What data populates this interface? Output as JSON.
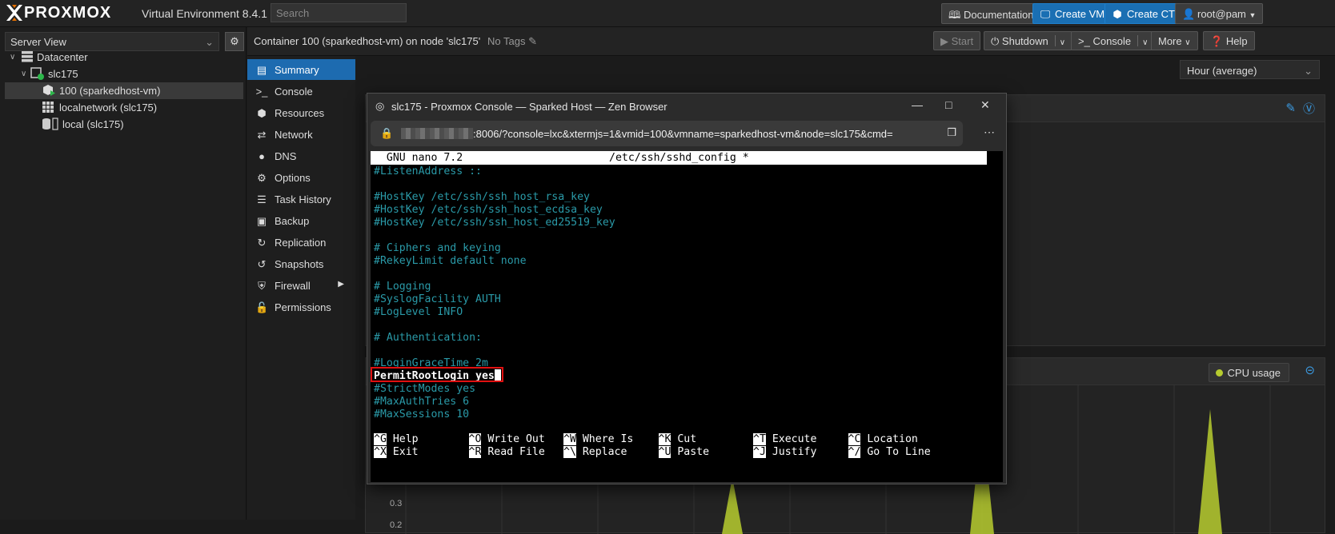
{
  "topbar": {
    "brand": "PROXMOX",
    "version": "Virtual Environment 8.4.1",
    "search_placeholder": "Search",
    "documentation": "Documentation",
    "create_vm": "Create VM",
    "create_ct": "Create CT",
    "user": "root@pam"
  },
  "sidebar": {
    "view_select": "Server View",
    "tree": [
      {
        "label": "Datacenter"
      },
      {
        "label": "slc175"
      },
      {
        "label": "100 (sparkedhost-vm)"
      },
      {
        "label": "localnetwork (slc175)"
      },
      {
        "label": "local (slc175)"
      }
    ]
  },
  "content_header": {
    "title": "Container 100 (sparkedhost-vm) on node 'slc175'",
    "tags": "No Tags",
    "start": "Start",
    "shutdown": "Shutdown",
    "console": "Console",
    "more": "More",
    "help": "Help"
  },
  "nav": {
    "items": [
      {
        "label": "Summary"
      },
      {
        "label": "Console"
      },
      {
        "label": "Resources"
      },
      {
        "label": "Network"
      },
      {
        "label": "DNS"
      },
      {
        "label": "Options"
      },
      {
        "label": "Task History"
      },
      {
        "label": "Backup"
      },
      {
        "label": "Replication"
      },
      {
        "label": "Snapshots"
      },
      {
        "label": "Firewall"
      },
      {
        "label": "Permissions"
      }
    ]
  },
  "main": {
    "timeframe": "Hour (average)",
    "cpu_legend": "CPU usage",
    "y_ticks": [
      "0.3",
      "0.2"
    ]
  },
  "browser": {
    "title": "slc175 - Proxmox Console — Sparked Host — Zen Browser",
    "url": ":8006/?console=lxc&xtermjs=1&vmid=100&vmname=sparkedhost-vm&node=slc175&cmd="
  },
  "terminal": {
    "header_left": "  GNU nano 7.2",
    "header_center": "/etc/ssh/sshd_config *",
    "lines": [
      "#ListenAddress ::",
      "",
      "#HostKey /etc/ssh/ssh_host_rsa_key",
      "#HostKey /etc/ssh/ssh_host_ecdsa_key",
      "#HostKey /etc/ssh/ssh_host_ed25519_key",
      "",
      "# Ciphers and keying",
      "#RekeyLimit default none",
      "",
      "# Logging",
      "#SyslogFacility AUTH",
      "#LogLevel INFO",
      "",
      "# Authentication:",
      "",
      "#LoginGraceTime 2m",
      "PermitRootLogin yes",
      "#StrictModes yes",
      "#MaxAuthTries 6",
      "#MaxSessions 10"
    ],
    "shortcuts_row1": [
      {
        "key": "^G",
        "label": "Help"
      },
      {
        "key": "^O",
        "label": "Write Out"
      },
      {
        "key": "^W",
        "label": "Where Is"
      },
      {
        "key": "^K",
        "label": "Cut"
      },
      {
        "key": "^T",
        "label": "Execute"
      },
      {
        "key": "^C",
        "label": "Location"
      }
    ],
    "shortcuts_row2": [
      {
        "key": "^X",
        "label": "Exit"
      },
      {
        "key": "^R",
        "label": "Read File"
      },
      {
        "key": "^\\",
        "label": "Replace"
      },
      {
        "key": "^U",
        "label": "Paste"
      },
      {
        "key": "^J",
        "label": "Justify"
      },
      {
        "key": "^/",
        "label": "Go To Line"
      }
    ]
  },
  "colors": {
    "accent": "#1d6bb0",
    "cpu_series": "#b7cc2f",
    "highlight": "#e01010",
    "terminal_comment": "#2a9aa8"
  }
}
